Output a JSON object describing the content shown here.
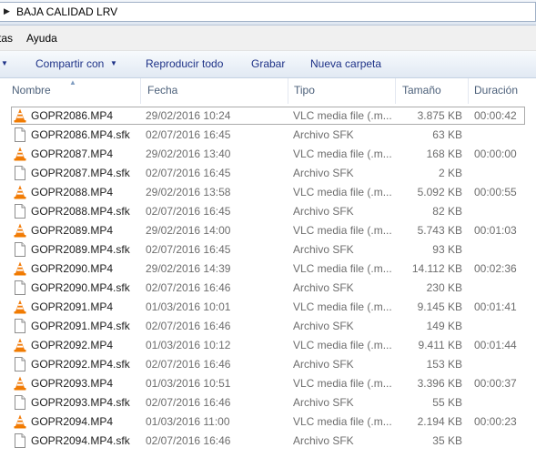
{
  "address": {
    "path": "BAJA CALIDAD LRV"
  },
  "menu": {
    "items": [
      "tas",
      "Ayuda"
    ]
  },
  "commands": {
    "share": "Compartir con",
    "play_all": "Reproducir todo",
    "burn": "Grabar",
    "new_folder": "Nueva carpeta"
  },
  "columns": {
    "name": "Nombre",
    "date": "Fecha",
    "type": "Tipo",
    "size": "Tamaño",
    "duration": "Duración"
  },
  "files": [
    {
      "name": "GOPR2086.MP4",
      "date": "29/02/2016 10:24",
      "type": "VLC media file (.m...",
      "size": "3.875 KB",
      "duration": "00:00:42",
      "icon": "vlc-cone-icon",
      "selected": true
    },
    {
      "name": "GOPR2086.MP4.sfk",
      "date": "02/07/2016 16:45",
      "type": "Archivo SFK",
      "size": "63 KB",
      "duration": "",
      "icon": "blank-file-icon"
    },
    {
      "name": "GOPR2087.MP4",
      "date": "29/02/2016 13:40",
      "type": "VLC media file (.m...",
      "size": "168 KB",
      "duration": "00:00:00",
      "icon": "vlc-cone-icon"
    },
    {
      "name": "GOPR2087.MP4.sfk",
      "date": "02/07/2016 16:45",
      "type": "Archivo SFK",
      "size": "2 KB",
      "duration": "",
      "icon": "blank-file-icon"
    },
    {
      "name": "GOPR2088.MP4",
      "date": "29/02/2016 13:58",
      "type": "VLC media file (.m...",
      "size": "5.092 KB",
      "duration": "00:00:55",
      "icon": "vlc-cone-icon"
    },
    {
      "name": "GOPR2088.MP4.sfk",
      "date": "02/07/2016 16:45",
      "type": "Archivo SFK",
      "size": "82 KB",
      "duration": "",
      "icon": "blank-file-icon"
    },
    {
      "name": "GOPR2089.MP4",
      "date": "29/02/2016 14:00",
      "type": "VLC media file (.m...",
      "size": "5.743 KB",
      "duration": "00:01:03",
      "icon": "vlc-cone-icon"
    },
    {
      "name": "GOPR2089.MP4.sfk",
      "date": "02/07/2016 16:45",
      "type": "Archivo SFK",
      "size": "93 KB",
      "duration": "",
      "icon": "blank-file-icon"
    },
    {
      "name": "GOPR2090.MP4",
      "date": "29/02/2016 14:39",
      "type": "VLC media file (.m...",
      "size": "14.112 KB",
      "duration": "00:02:36",
      "icon": "vlc-cone-icon"
    },
    {
      "name": "GOPR2090.MP4.sfk",
      "date": "02/07/2016 16:46",
      "type": "Archivo SFK",
      "size": "230 KB",
      "duration": "",
      "icon": "blank-file-icon"
    },
    {
      "name": "GOPR2091.MP4",
      "date": "01/03/2016 10:01",
      "type": "VLC media file (.m...",
      "size": "9.145 KB",
      "duration": "00:01:41",
      "icon": "vlc-cone-icon"
    },
    {
      "name": "GOPR2091.MP4.sfk",
      "date": "02/07/2016 16:46",
      "type": "Archivo SFK",
      "size": "149 KB",
      "duration": "",
      "icon": "blank-file-icon"
    },
    {
      "name": "GOPR2092.MP4",
      "date": "01/03/2016 10:12",
      "type": "VLC media file (.m...",
      "size": "9.411 KB",
      "duration": "00:01:44",
      "icon": "vlc-cone-icon"
    },
    {
      "name": "GOPR2092.MP4.sfk",
      "date": "02/07/2016 16:46",
      "type": "Archivo SFK",
      "size": "153 KB",
      "duration": "",
      "icon": "blank-file-icon"
    },
    {
      "name": "GOPR2093.MP4",
      "date": "01/03/2016 10:51",
      "type": "VLC media file (.m...",
      "size": "3.396 KB",
      "duration": "00:00:37",
      "icon": "vlc-cone-icon"
    },
    {
      "name": "GOPR2093.MP4.sfk",
      "date": "02/07/2016 16:46",
      "type": "Archivo SFK",
      "size": "55 KB",
      "duration": "",
      "icon": "blank-file-icon"
    },
    {
      "name": "GOPR2094.MP4",
      "date": "01/03/2016 11:00",
      "type": "VLC media file (.m...",
      "size": "2.194 KB",
      "duration": "00:00:23",
      "icon": "vlc-cone-icon"
    },
    {
      "name": "GOPR2094.MP4.sfk",
      "date": "02/07/2016 16:46",
      "type": "Archivo SFK",
      "size": "35 KB",
      "duration": "",
      "icon": "blank-file-icon"
    }
  ]
}
